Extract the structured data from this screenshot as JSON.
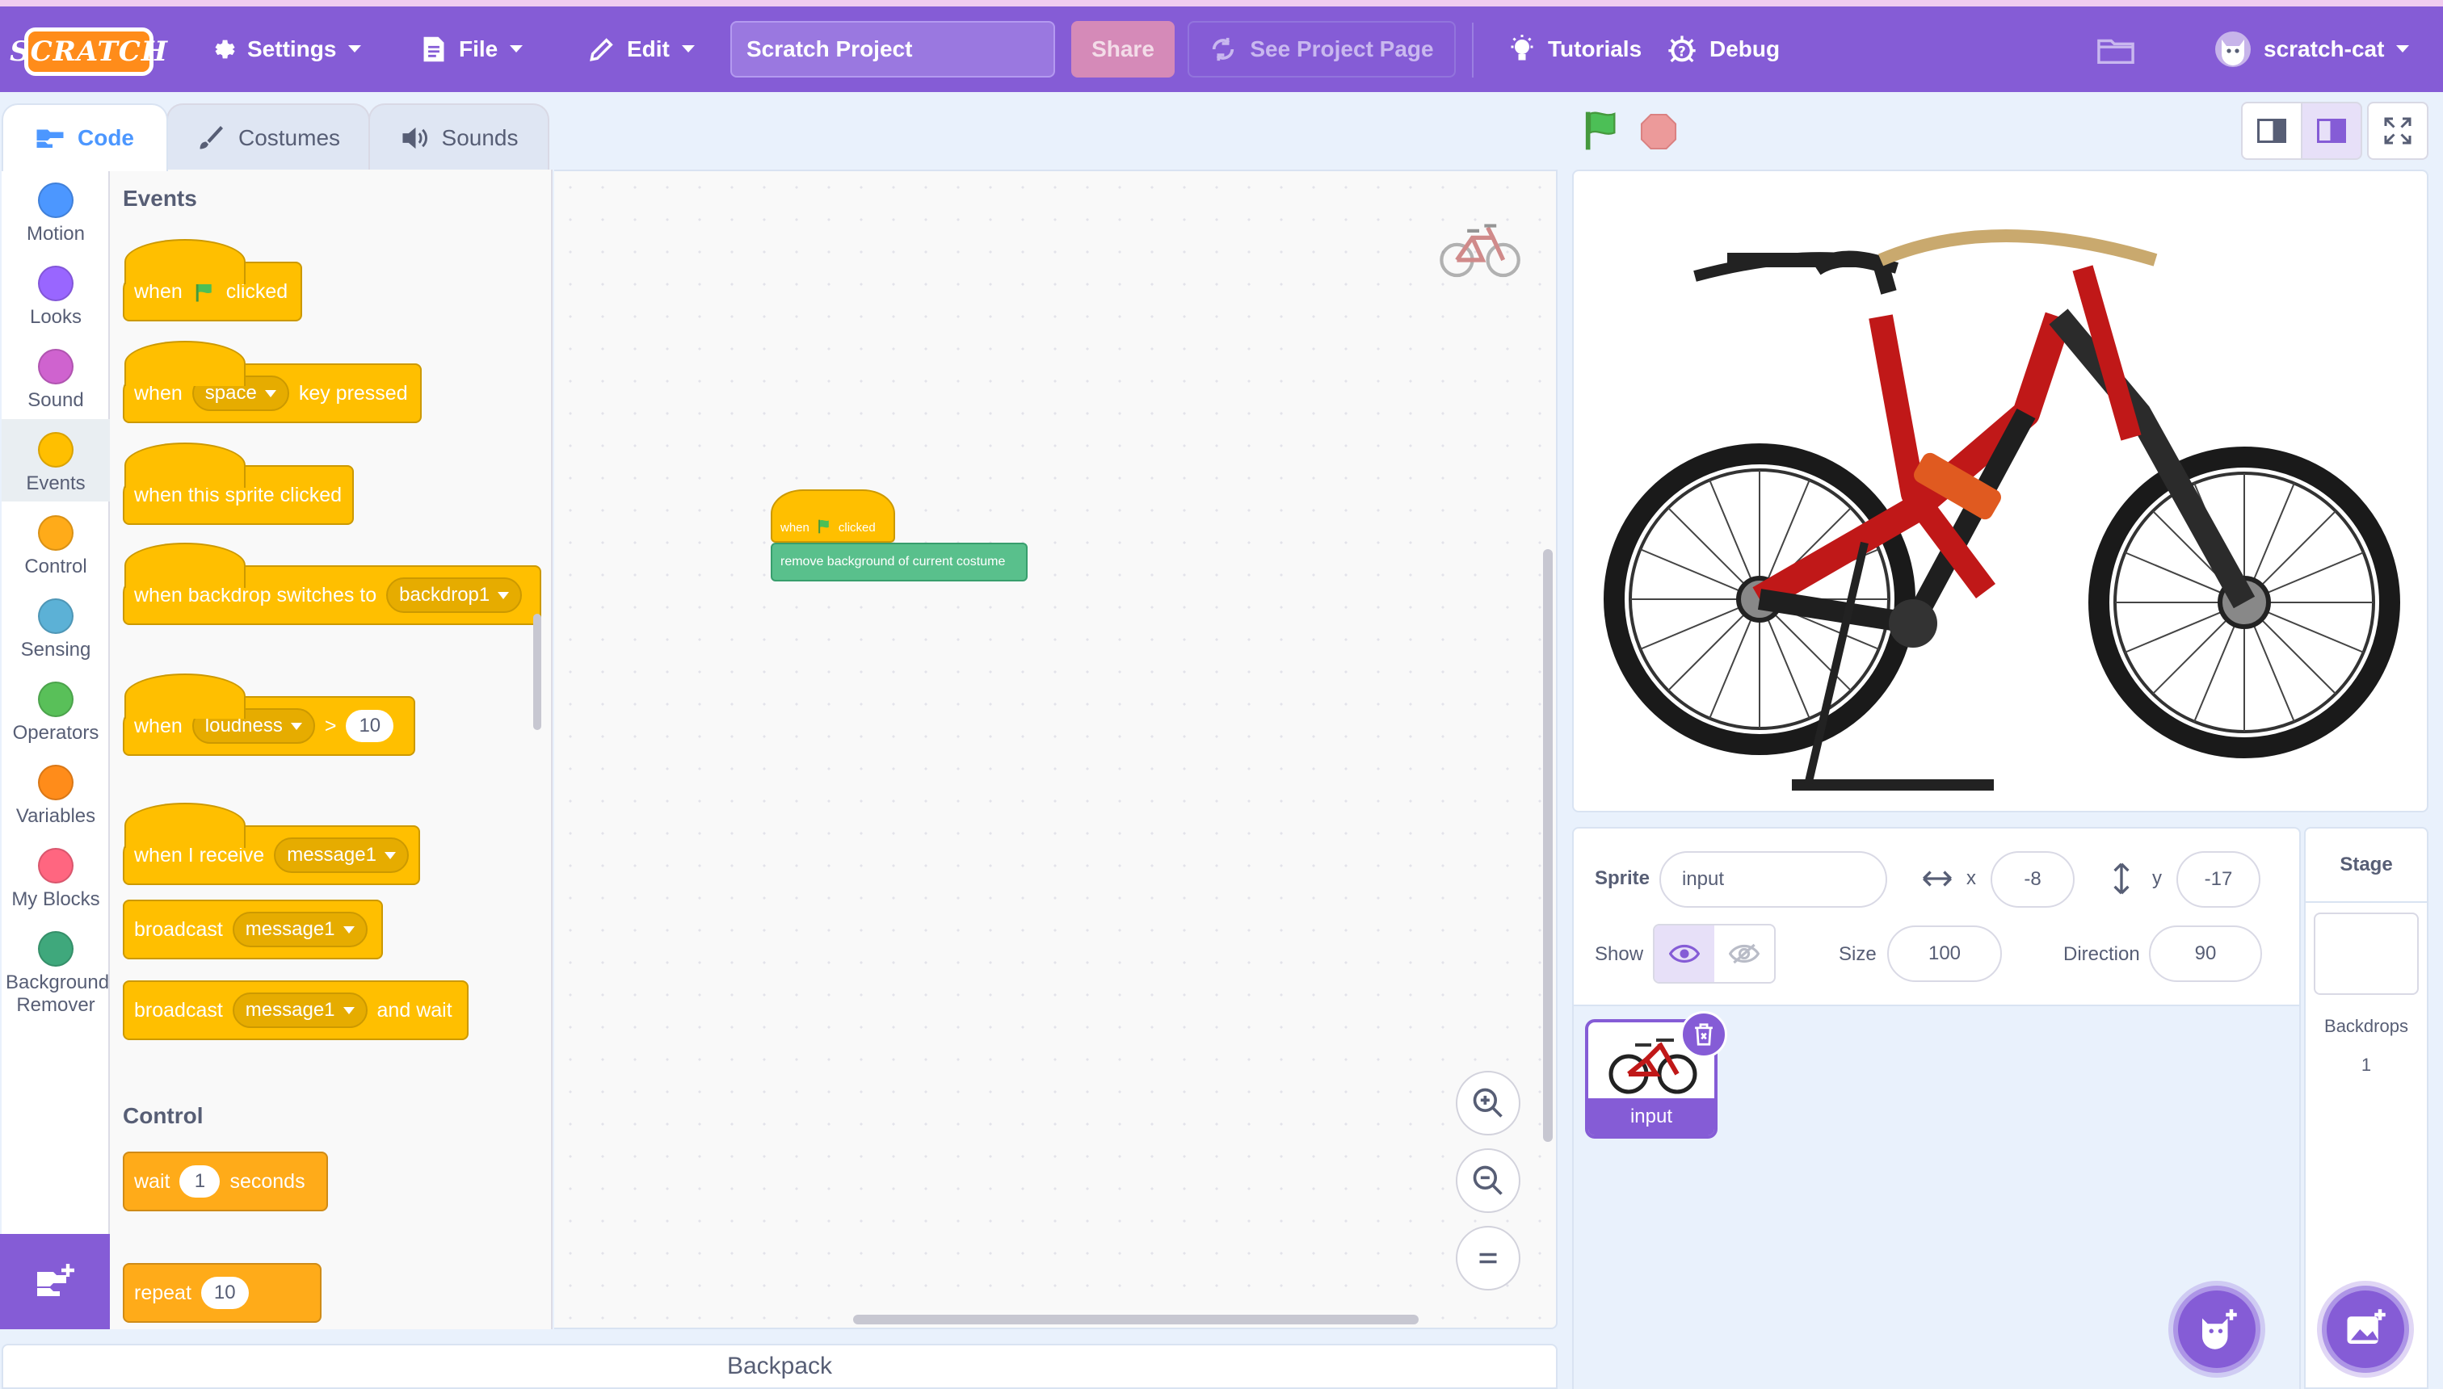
{
  "menubar": {
    "logo": "SCRATCH",
    "settings": "Settings",
    "file": "File",
    "edit": "Edit",
    "project_title": "Scratch Project",
    "share": "Share",
    "see_project_page": "See Project Page",
    "tutorials": "Tutorials",
    "debug": "Debug",
    "username": "scratch-cat",
    "accent_color": "#855cd6"
  },
  "tabs": {
    "code": "Code",
    "costumes": "Costumes",
    "sounds": "Sounds"
  },
  "categories": [
    {
      "label": "Motion",
      "color": "#4c97ff"
    },
    {
      "label": "Looks",
      "color": "#9966ff"
    },
    {
      "label": "Sound",
      "color": "#cf63cf"
    },
    {
      "label": "Events",
      "color": "#ffbf00"
    },
    {
      "label": "Control",
      "color": "#ffab19"
    },
    {
      "label": "Sensing",
      "color": "#5cb1d6"
    },
    {
      "label": "Operators",
      "color": "#59c059"
    },
    {
      "label": "Variables",
      "color": "#ff8c1a"
    },
    {
      "label": "My Blocks",
      "color": "#ff6680"
    },
    {
      "label": "Background Remover",
      "color": "#3fa87c"
    }
  ],
  "palette": {
    "events_heading": "Events",
    "control_heading": "Control",
    "blocks": {
      "when_flag": {
        "pre": "when",
        "post": "clicked"
      },
      "when_key": {
        "pre": "when",
        "key": "space",
        "post": "key pressed"
      },
      "when_sprite": "when this sprite clicked",
      "when_backdrop": {
        "pre": "when backdrop switches to",
        "value": "backdrop1"
      },
      "when_loudness": {
        "pre": "when",
        "value": "loudness",
        "op": ">",
        "num": "10"
      },
      "when_receive": {
        "pre": "when I receive",
        "value": "message1"
      },
      "broadcast": {
        "pre": "broadcast",
        "value": "message1"
      },
      "broadcast_wait": {
        "pre": "broadcast",
        "value": "message1",
        "post": "and wait"
      },
      "wait": {
        "pre": "wait",
        "num": "1",
        "post": "seconds"
      },
      "repeat": {
        "pre": "repeat",
        "num": "10"
      }
    }
  },
  "script": {
    "hat": {
      "pre": "when",
      "post": "clicked"
    },
    "ext_block": "remove background of current costume"
  },
  "backpack": "Backpack",
  "sprite_info": {
    "sprite_label": "Sprite",
    "sprite_name": "input",
    "x_label": "x",
    "x_value": "-8",
    "y_label": "y",
    "y_value": "-17",
    "show_label": "Show",
    "size_label": "Size",
    "size_value": "100",
    "direction_label": "Direction",
    "direction_value": "90"
  },
  "sprites": [
    {
      "name": "input"
    }
  ],
  "stage_selector": {
    "title": "Stage",
    "backdrops_label": "Backdrops",
    "backdrops_count": "1"
  }
}
